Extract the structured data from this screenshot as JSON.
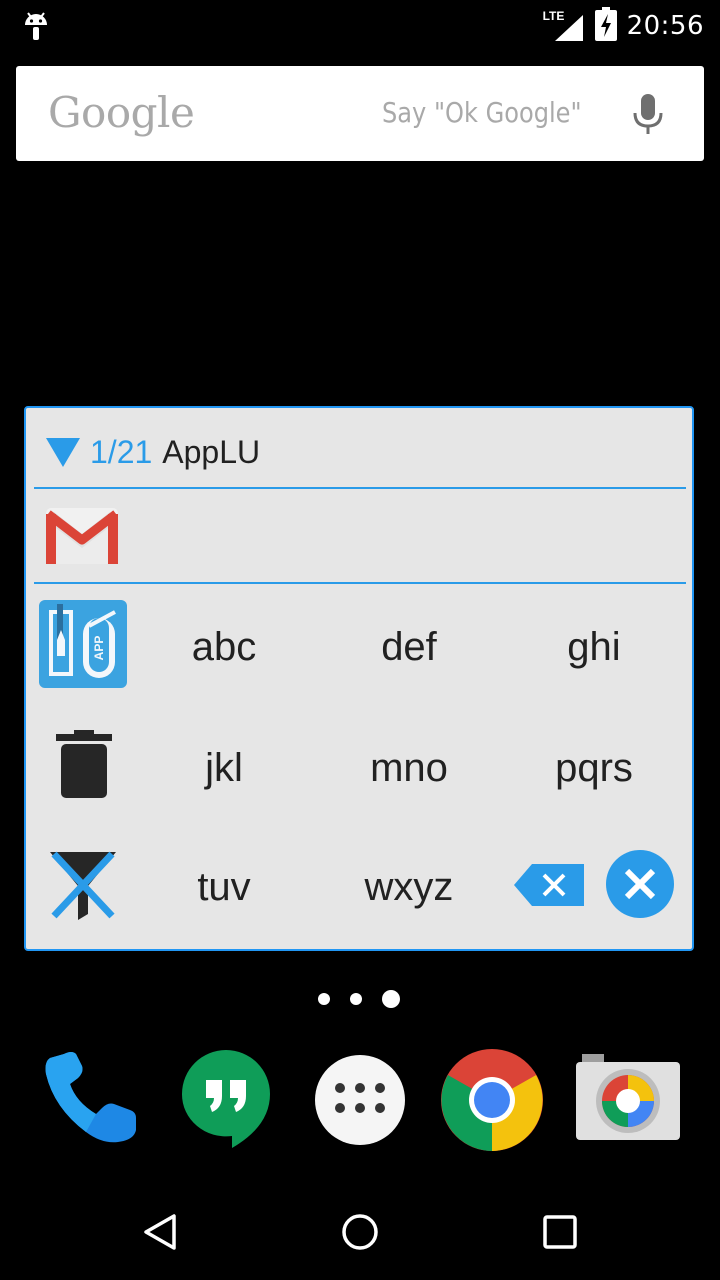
{
  "status_bar": {
    "network_label": "LTE",
    "time": "20:56",
    "icons": [
      "android-debug-icon",
      "signal-icon",
      "battery-charging-icon"
    ]
  },
  "search_bar": {
    "logo_text": "Google",
    "hint": "Say \"Ok Google\"",
    "icon": "mic-icon"
  },
  "widget": {
    "counter": "1/21",
    "title": "AppLU",
    "recent_app_icon": "gmail-icon",
    "keys": {
      "row1": [
        "abc",
        "def",
        "ghi"
      ],
      "row2": [
        "jkl",
        "mno",
        "pqrs"
      ],
      "row3": [
        "tuv",
        "wxyz"
      ]
    },
    "side_icons": [
      "applu-logo-icon",
      "trash-icon",
      "filter-off-icon"
    ],
    "action_icons": [
      "backspace-icon",
      "close-circle-icon"
    ],
    "colors": {
      "accent": "#2a9be8",
      "panel": "#e6e6e6"
    }
  },
  "home_pages": {
    "count": 3,
    "current": 3
  },
  "dock": {
    "apps": [
      "phone-icon",
      "hangouts-icon",
      "app-drawer-icon",
      "chrome-icon",
      "camera-icon"
    ]
  },
  "nav_bar": {
    "buttons": [
      "back-icon",
      "home-icon",
      "recents-icon"
    ]
  }
}
